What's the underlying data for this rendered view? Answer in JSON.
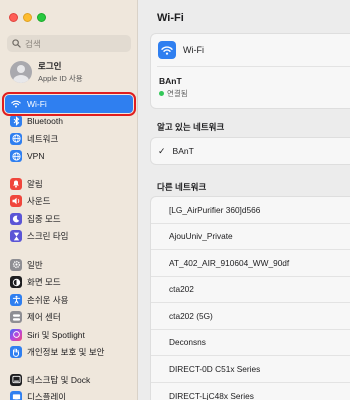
{
  "sidebar": {
    "search_placeholder": "검색",
    "account": {
      "name": "로그인",
      "subtitle": "Apple ID 사용"
    },
    "items": [
      {
        "label": "Wi-Fi",
        "icon": "wifi-icon",
        "color": "#2f7ff0"
      },
      {
        "label": "Bluetooth",
        "icon": "bluetooth-icon",
        "color": "#2f7ff0"
      },
      {
        "label": "네트워크",
        "icon": "globe-icon",
        "color": "#2f7ff0"
      },
      {
        "label": "VPN",
        "icon": "vpn-globe-icon",
        "color": "#2f7ff0"
      },
      {
        "label": "알림",
        "icon": "bell-icon",
        "color": "#f0463c"
      },
      {
        "label": "사운드",
        "icon": "speaker-icon",
        "color": "#f0463c"
      },
      {
        "label": "집중 모드",
        "icon": "moon-icon",
        "color": "#5b55d6"
      },
      {
        "label": "스크린 타임",
        "icon": "hourglass-icon",
        "color": "#5b55d6"
      },
      {
        "label": "일반",
        "icon": "gear-icon",
        "color": "#8e8e93"
      },
      {
        "label": "화면 모드",
        "icon": "appearance-icon",
        "color": "#1d1d1f"
      },
      {
        "label": "손쉬운 사용",
        "icon": "accessibility-icon",
        "color": "#2f7ff0"
      },
      {
        "label": "제어 센터",
        "icon": "control-center-icon",
        "color": "#8e8e93"
      },
      {
        "label": "Siri 및 Spotlight",
        "icon": "siri-icon",
        "color": "#b545e0"
      },
      {
        "label": "개인정보 보호 및 보안",
        "icon": "hand-icon",
        "color": "#2f7ff0"
      },
      {
        "label": "데스크탑 및 Dock",
        "icon": "dock-icon",
        "color": "#1d1d1f"
      },
      {
        "label": "디스플레이",
        "icon": "display-icon",
        "color": "#2f7ff0"
      }
    ]
  },
  "main": {
    "title": "Wi-Fi",
    "wifi_label": "Wi-Fi",
    "connected_ssid": "BAnT",
    "connected_status": "연결됨",
    "known_title": "알고 있는 네트워크",
    "known_networks": [
      "BAnT"
    ],
    "other_title": "다른 네트워크",
    "other_networks": [
      "[LG_AirPurifier 360]d566",
      "AjouUniv_Private",
      "AT_402_AIR_910604_WW_90df",
      "cta202",
      "cta202 (5G)",
      "Deconsns",
      "DIRECT-0D C51x Series",
      "DIRECT-LjC48x Series"
    ]
  }
}
